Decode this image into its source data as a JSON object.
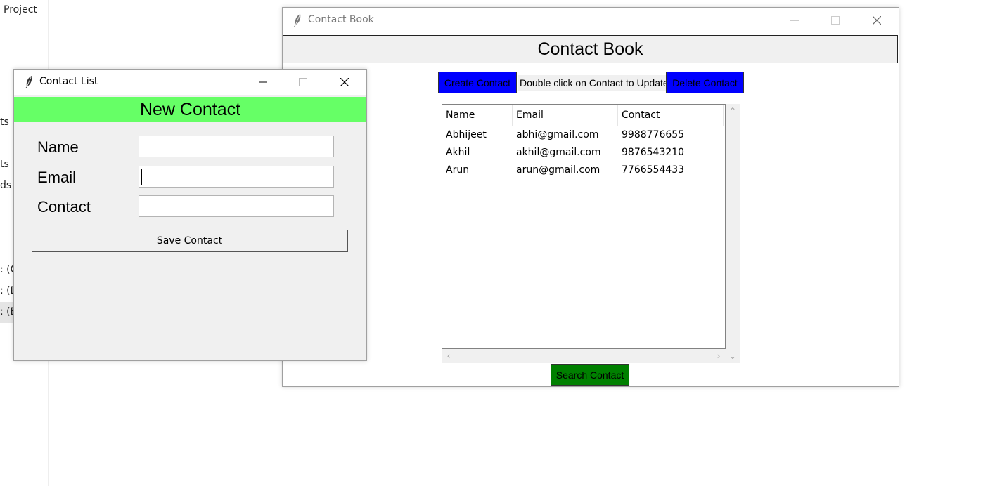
{
  "background": {
    "project_label": "Project",
    "fragments": [
      "ts",
      "ts",
      "ds",
      ": (C",
      ": (D",
      ": (E"
    ]
  },
  "contact_book": {
    "window_title": "Contact Book",
    "header": "Contact Book",
    "create_button": "Create Contact",
    "hint": "Double click on Contact to Update!",
    "delete_button": "Delete Contact",
    "search_button": "Search Contact",
    "table": {
      "columns": [
        "Name",
        "Email",
        "Contact"
      ],
      "rows": [
        [
          "Abhijeet",
          "abhi@gmail.com",
          "9988776655"
        ],
        [
          "Akhil",
          "akhil@gmail.com",
          "9876543210"
        ],
        [
          "Arun",
          "arun@gmail.com",
          "7766554433"
        ]
      ]
    }
  },
  "contact_list": {
    "window_title": "Contact List",
    "header": "New Contact",
    "fields": [
      {
        "label": "Name",
        "value": ""
      },
      {
        "label": "Email",
        "value": ""
      },
      {
        "label": "Contact",
        "value": ""
      }
    ],
    "save_button": "Save Contact"
  },
  "colors": {
    "button_blue": "#0000ff",
    "button_green": "#008000",
    "header_green": "#66ff66"
  },
  "icons": {
    "window_icon": "feather-icon",
    "minimize": "minimize-icon",
    "maximize": "maximize-icon",
    "close": "close-icon"
  }
}
